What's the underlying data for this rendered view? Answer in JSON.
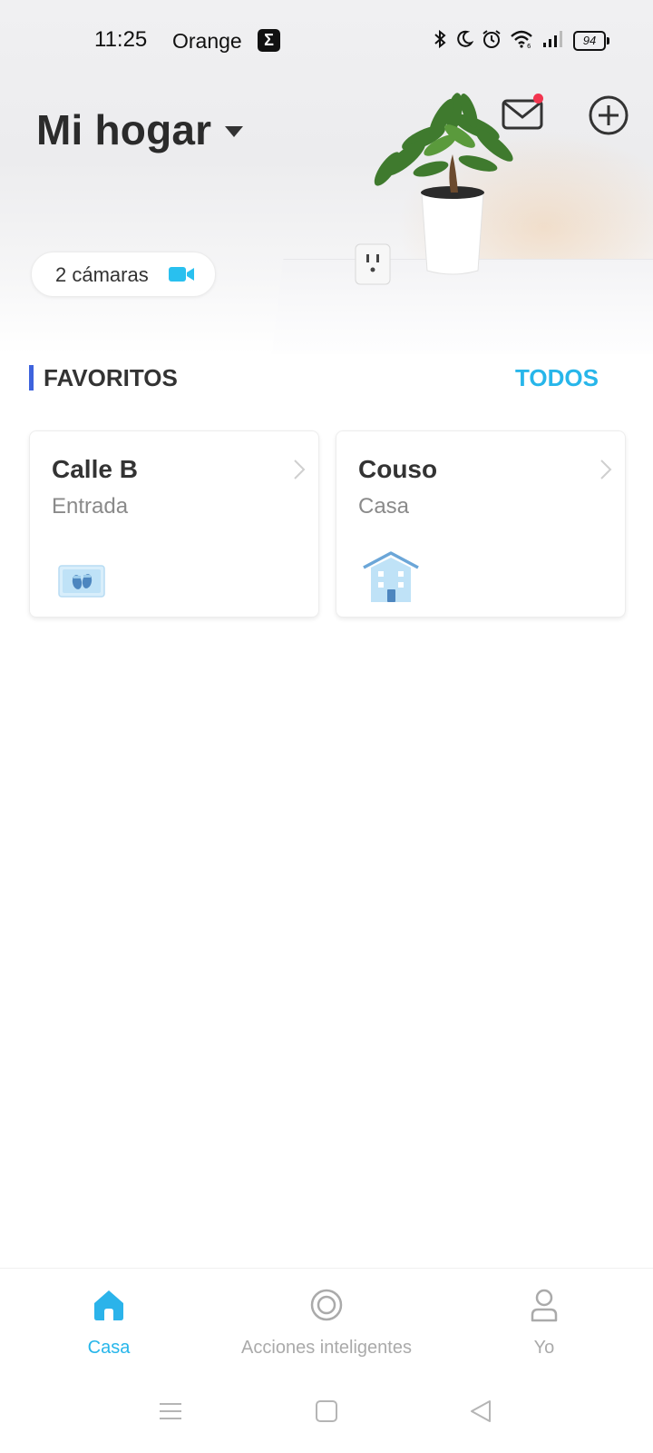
{
  "status_bar": {
    "time": "11:25",
    "carrier": "Orange",
    "app_badge": "Σ",
    "battery": "94",
    "icons": [
      "bluetooth-icon",
      "moon-icon",
      "alarm-icon",
      "wifi-icon",
      "signal-icon",
      "battery-icon"
    ]
  },
  "header": {
    "title": "Mi hogar",
    "has_unread_messages": true
  },
  "cameras_chip": {
    "label": "2 cámaras",
    "icon": "video-camera-icon"
  },
  "favorites": {
    "section_title": "FAVORITOS",
    "all_link": "TODOS",
    "cards": [
      {
        "title": "Calle B",
        "subtitle": "Entrada",
        "icon": "doormat-icon"
      },
      {
        "title": "Couso",
        "subtitle": "Casa",
        "icon": "house-icon"
      }
    ]
  },
  "bottom_nav": {
    "items": [
      {
        "label": "Casa",
        "icon": "home-icon",
        "active": true
      },
      {
        "label": "Acciones inteligentes",
        "icon": "smart-actions-icon",
        "active": false
      },
      {
        "label": "Yo",
        "icon": "profile-icon",
        "active": false
      }
    ]
  },
  "colors": {
    "accent": "#27b6ea",
    "section_marker": "#3e63dd",
    "notification_dot": "#f2354f",
    "inactive": "#aaaaaa"
  }
}
